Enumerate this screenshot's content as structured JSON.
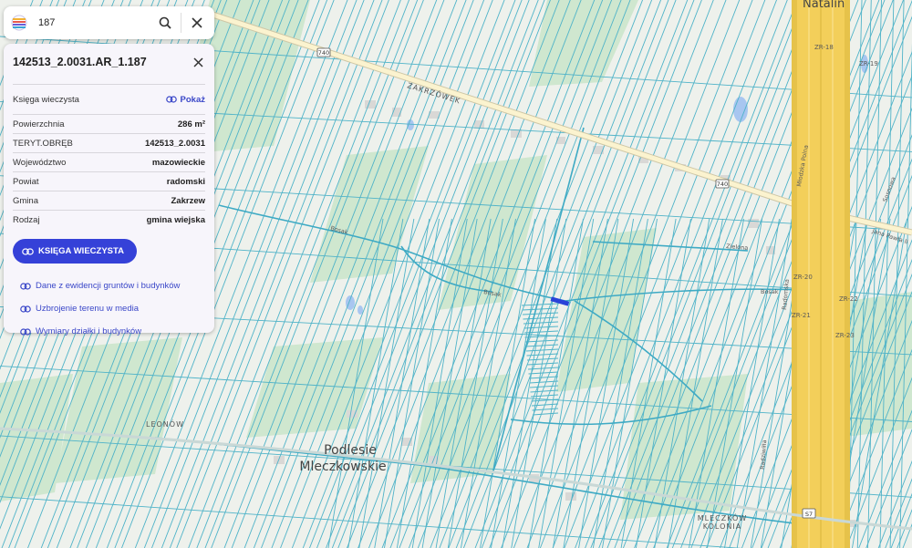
{
  "search": {
    "value": "187"
  },
  "panel": {
    "title": "142513_2.0031.AR_1.187",
    "kw_label": "Księga wieczysta",
    "kw_link": "Pokaż",
    "rows": [
      {
        "label": "Powierzchnia",
        "value": "286 m²"
      },
      {
        "label": "TERYT.OBRĘB",
        "value": "142513_2.0031"
      },
      {
        "label": "Województwo",
        "value": "mazowieckie"
      },
      {
        "label": "Powiat",
        "value": "radomski"
      },
      {
        "label": "Gmina",
        "value": "Zakrzew"
      },
      {
        "label": "Rodzaj",
        "value": "gmina wiejska"
      }
    ],
    "primary_button": "KSIĘGA WIECZYSTA",
    "links": [
      "Dane z ewidencji gruntów i budynków",
      "Uzbrojenie terenu w media",
      "Wymiary działki i budynków"
    ]
  },
  "map": {
    "labels": {
      "natalin": "Natalin",
      "zakrzowek": "ZAKRZÓWEK",
      "podlesie_1": "Podlesie",
      "podlesie_2": "Mleczkowskie",
      "leonow": "LEONÓW",
      "mleczkow_1": "MLECZKÓW",
      "mleczkow_2": "KOLONIA",
      "road_740a": "740",
      "road_740b": "740",
      "road_s7": "S7",
      "st_bosak1": "Bosak",
      "st_bosak2": "Bosak",
      "st_bosak3": "Bosak",
      "st_zielona": "Zielona",
      "st_mlodzka": "Młodzka Polna",
      "st_radom": "Radomska",
      "st_jana": "Jana Pawła II",
      "st_radziwi": "Radziwiłła",
      "st_sosnowa": "Sosnowa",
      "zr18": "ZR-18",
      "zr19": "ZR-19",
      "zr20": "ZR-20",
      "zr21": "ZR-21",
      "zr22": "ZR-22",
      "zr23": "ZR-23"
    }
  },
  "colors": {
    "parcel_lines": "#4fb3c8",
    "selected_parcel": "#2a43d8",
    "highway": "#f3cf5a",
    "accent": "#3541d8"
  }
}
